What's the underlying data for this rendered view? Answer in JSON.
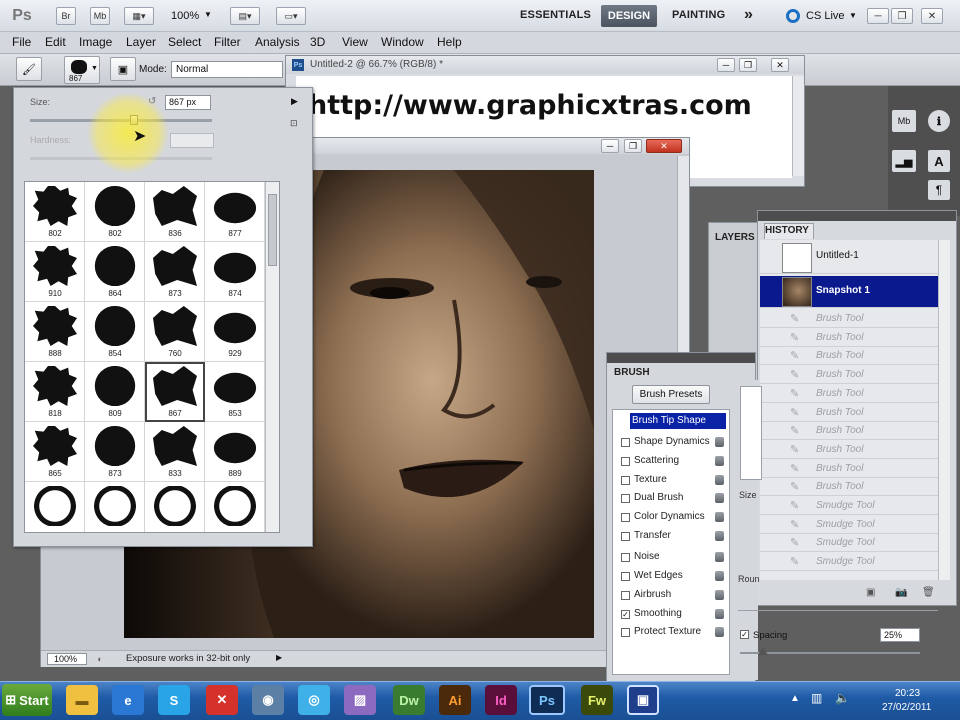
{
  "app": {
    "logo": "Ps",
    "quick_buttons": [
      "Br",
      "Mb"
    ],
    "zoom": "100%",
    "workspaces": [
      "ESSENTIALS",
      "DESIGN",
      "PAINTING"
    ],
    "more": "»",
    "cs_live": "CS Live",
    "window_controls": [
      "─",
      "❐",
      "✕"
    ]
  },
  "menu": [
    "File",
    "Edit",
    "Image",
    "Layer",
    "Select",
    "Filter",
    "Analysis",
    "3D",
    "View",
    "Window",
    "Help"
  ],
  "options": {
    "brush_size_label": "867",
    "mode_label": "Mode:",
    "mode_value": "Normal"
  },
  "doc1": {
    "title": "Untitled-2 @ 66.7% (RGB/8) *",
    "text": "http://www.graphicxtras.com"
  },
  "brush_picker": {
    "size_label": "Size:",
    "size_value": "867 px",
    "size_fraction": 0.57,
    "hardness_label": "Hardness:",
    "brushes": [
      "802",
      "802",
      "836",
      "877",
      "910",
      "864",
      "873",
      "874",
      "888",
      "854",
      "760",
      "929",
      "818",
      "809",
      "867",
      "853",
      "865",
      "873",
      "833",
      "889",
      "",
      "",
      "",
      ""
    ],
    "selected_index": 14
  },
  "status": {
    "zoom": "100%",
    "message": "Exposure works in 32-bit only"
  },
  "history": {
    "title": "HISTORY",
    "layers_tab": "LAYERS",
    "items": [
      {
        "label": "Untitled-1",
        "type": "doc"
      },
      {
        "label": "Snapshot 1",
        "type": "snapshot"
      },
      {
        "label": "Brush Tool"
      },
      {
        "label": "Brush Tool"
      },
      {
        "label": "Brush Tool"
      },
      {
        "label": "Brush Tool"
      },
      {
        "label": "Brush Tool"
      },
      {
        "label": "Brush Tool"
      },
      {
        "label": "Brush Tool"
      },
      {
        "label": "Brush Tool"
      },
      {
        "label": "Brush Tool"
      },
      {
        "label": "Brush Tool"
      },
      {
        "label": "Smudge Tool"
      },
      {
        "label": "Smudge Tool"
      },
      {
        "label": "Smudge Tool"
      },
      {
        "label": "Smudge Tool"
      }
    ]
  },
  "brush_panel": {
    "title": "BRUSH",
    "presets_button": "Brush Presets",
    "tip_shape": "Brush Tip Shape",
    "options": [
      {
        "label": "Shape Dynamics",
        "checked": false
      },
      {
        "label": "Scattering",
        "checked": false
      },
      {
        "label": "Texture",
        "checked": false
      },
      {
        "label": "Dual Brush",
        "checked": false
      },
      {
        "label": "Color Dynamics",
        "checked": false
      },
      {
        "label": "Transfer",
        "checked": false
      },
      {
        "label": "Noise",
        "checked": false
      },
      {
        "label": "Wet Edges",
        "checked": false
      },
      {
        "label": "Airbrush",
        "checked": false
      },
      {
        "label": "Smoothing",
        "checked": true
      },
      {
        "label": "Protect Texture",
        "checked": false
      }
    ],
    "spacing_label": "Spacing",
    "spacing_value": "25%",
    "spacing_checked": true,
    "size_label_partial": "Size",
    "round_label_partial": "Roun"
  },
  "taskbar": {
    "start": "Start",
    "apps": [
      "Dw",
      "Ai",
      "Id",
      "Ps",
      "Fw"
    ],
    "time": "20:23",
    "date": "27/02/2011"
  },
  "colors": {
    "history_selected": "#0a1a8e",
    "start_green": "#3d9b2f",
    "accent_blue": "#1f5ba6"
  }
}
